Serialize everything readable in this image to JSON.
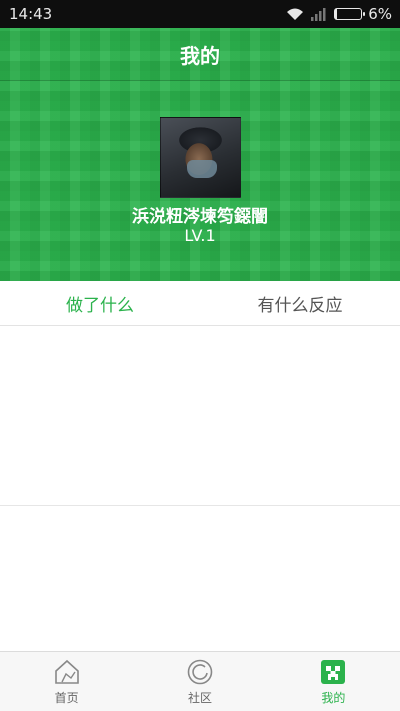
{
  "status_bar": {
    "time": "14:43",
    "battery_percent": "6%",
    "battery_level": 0.06
  },
  "header": {
    "title": "我的"
  },
  "profile": {
    "username": "浜涚粈涔堜笉鐚闇",
    "level": "LV.1"
  },
  "tabs": [
    {
      "label": "做了什么",
      "active": true
    },
    {
      "label": "有什么反应",
      "active": false
    }
  ],
  "bottom_nav": [
    {
      "label": "首页",
      "icon": "home-icon",
      "active": false
    },
    {
      "label": "社区",
      "icon": "community-icon",
      "active": false
    },
    {
      "label": "我的",
      "icon": "creeper-icon",
      "active": true
    }
  ],
  "colors": {
    "accent": "#2bb24c",
    "status_bar": "#0e0e0e",
    "inactive_text": "#555555"
  }
}
